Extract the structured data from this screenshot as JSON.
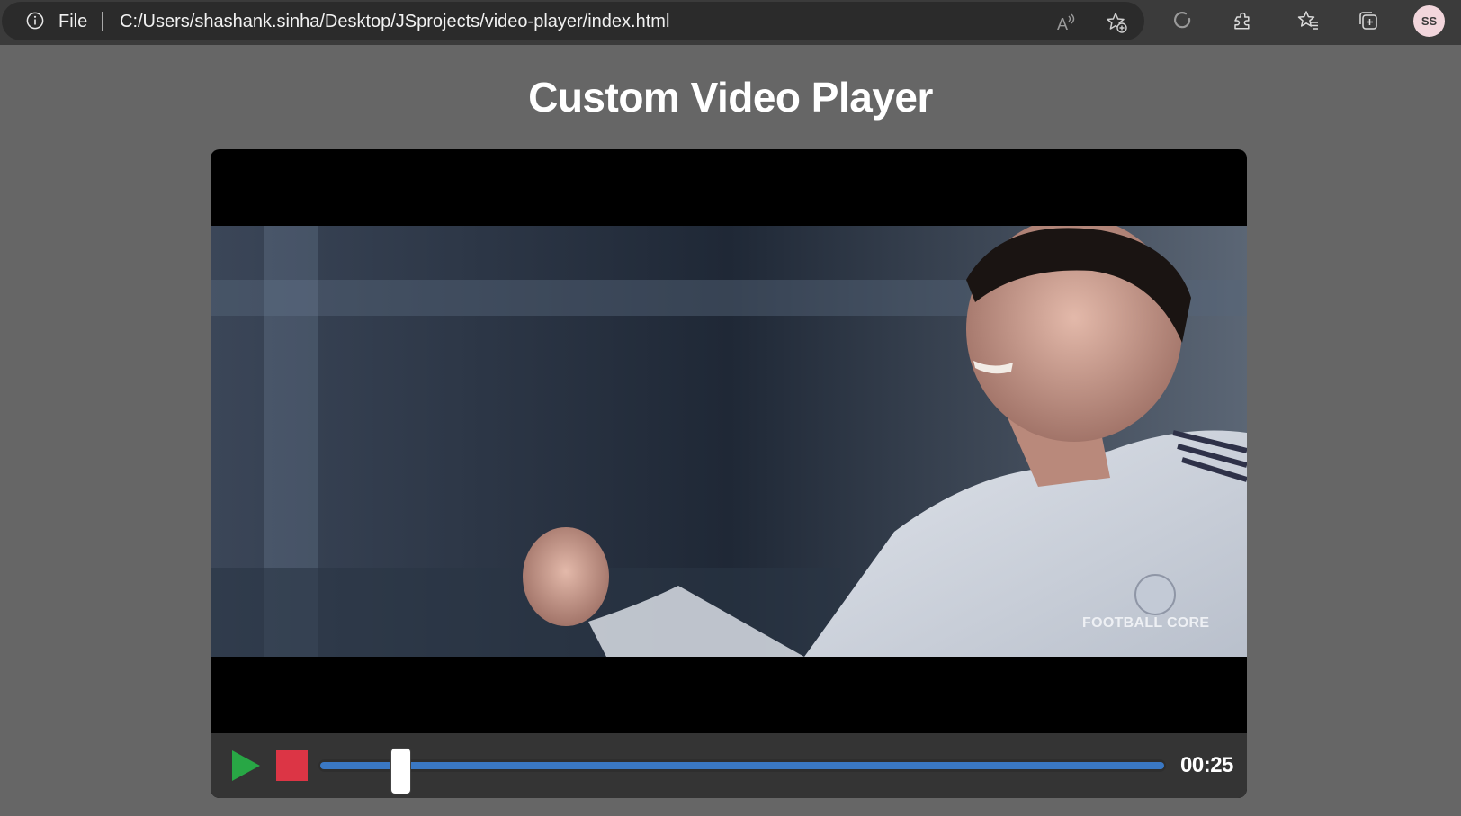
{
  "browser": {
    "file_label": "File",
    "address": "C:/Users/shashank.sinha/Desktop/JSprojects/video-player/index.html",
    "profile_initials": "SS",
    "icons": [
      "info-icon",
      "read-aloud-icon",
      "add-favorite-icon",
      "refresh-icon",
      "extensions-icon",
      "favorites-icon",
      "collections-icon"
    ]
  },
  "page": {
    "title": "Custom Video Player"
  },
  "video": {
    "watermark": "FOOTBALL CORE",
    "jersey_brand": "adidas"
  },
  "controls": {
    "play_icon": "play-icon",
    "stop_icon": "stop-icon",
    "progress_fraction": 0.087,
    "timestamp": "00:25",
    "colors": {
      "play": "#28a745",
      "stop": "#dc3545",
      "progress": "#3a78c4"
    }
  }
}
